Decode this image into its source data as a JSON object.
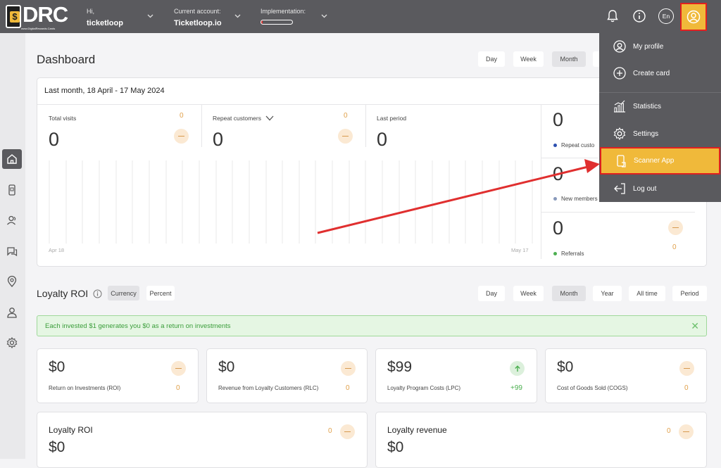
{
  "header": {
    "logo_text": "DRC",
    "logo_subtext": "www.DigitalRewards.Cards",
    "greeting_label": "Hi,",
    "user_name": "ticketloop",
    "account_label": "Current account:",
    "account_name": "Ticketloop.io",
    "implementation_label": "Implementation:",
    "implementation_progress": 0.05,
    "language": "En",
    "accent_color": "#f0b93a"
  },
  "sidebar": {
    "items": [
      {
        "name": "home",
        "icon": "home-icon",
        "active": true
      },
      {
        "name": "cards",
        "icon": "card-icon"
      },
      {
        "name": "customers",
        "icon": "users-icon"
      },
      {
        "name": "messages",
        "icon": "chat-icon"
      },
      {
        "name": "locations",
        "icon": "location-pin-icon"
      },
      {
        "name": "profile",
        "icon": "user-icon"
      },
      {
        "name": "settings",
        "icon": "gear-icon"
      }
    ]
  },
  "dashboard": {
    "title": "Dashboard",
    "period_tabs": [
      "Day",
      "Week",
      "Month"
    ],
    "selected_period": "Month",
    "range_label": "Last month, 18 April - 17 May 2024",
    "metrics": [
      {
        "label": "Total visits",
        "value": "0",
        "change": "0"
      },
      {
        "label": "Repeat customers",
        "value": "0",
        "change": "0"
      },
      {
        "label": "Last period",
        "value": "0"
      }
    ],
    "chart_start_label": "Apr 18",
    "chart_end_label": "May 17",
    "side_stats": [
      {
        "value": "0",
        "label": "Repeat custo",
        "dot_color": "#2c4fb0"
      },
      {
        "value": "0",
        "label": "New members",
        "dot_color": "#8899bb"
      },
      {
        "value": "0",
        "label": "Referrals",
        "dot_color": "#4caf50",
        "change": "0"
      }
    ]
  },
  "loyalty_roi": {
    "title": "Loyalty ROI",
    "modes": [
      "Currency",
      "Percent"
    ],
    "selected_mode": "Currency",
    "period_tabs": [
      "Day",
      "Week",
      "Month",
      "Year",
      "All time",
      "Period"
    ],
    "selected_period": "Month",
    "alert_text": "Each invested $1 generates you $0 as a return on investments",
    "cards": [
      {
        "value": "$0",
        "label": "Return on Investments (ROI)",
        "change": "0",
        "trend": "flat"
      },
      {
        "value": "$0",
        "label": "Revenue from Loyalty Customers (RLC)",
        "change": "0",
        "trend": "flat"
      },
      {
        "value": "$99",
        "label": "Loyalty Program Costs (LPC)",
        "change": "+99",
        "trend": "up"
      },
      {
        "value": "$0",
        "label": "Cost of Goods Sold (COGS)",
        "change": "0",
        "trend": "flat"
      }
    ],
    "bottom_cards": [
      {
        "title": "Loyalty ROI",
        "value": "$0",
        "change": "0"
      },
      {
        "title": "Loyalty revenue",
        "value": "$0",
        "change": "0"
      }
    ]
  },
  "user_menu": {
    "items": [
      {
        "label": "My profile",
        "icon": "user-circle-icon"
      },
      {
        "label": "Create card",
        "icon": "plus-circle-icon"
      },
      {
        "label": "Statistics",
        "icon": "chart-icon"
      },
      {
        "label": "Settings",
        "icon": "gear-icon"
      },
      {
        "label": "Scanner App",
        "icon": "phone-scan-icon",
        "highlighted": true
      },
      {
        "label": "Log out",
        "icon": "logout-icon"
      }
    ]
  }
}
